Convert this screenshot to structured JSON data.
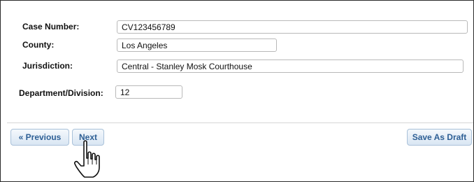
{
  "form": {
    "case_number": {
      "label": "Case Number:",
      "value": "CV123456789"
    },
    "county": {
      "label": "County:",
      "value": "Los Angeles"
    },
    "jurisdiction": {
      "label": "Jurisdiction:",
      "value": "Central - Stanley Mosk Courthouse"
    },
    "department": {
      "label": "Department/Division:",
      "value": "12"
    }
  },
  "buttons": {
    "previous": "« Previous",
    "next": "Next",
    "save_draft": "Save As Draft"
  },
  "cursor": {
    "icon": "hand-pointer-icon"
  }
}
